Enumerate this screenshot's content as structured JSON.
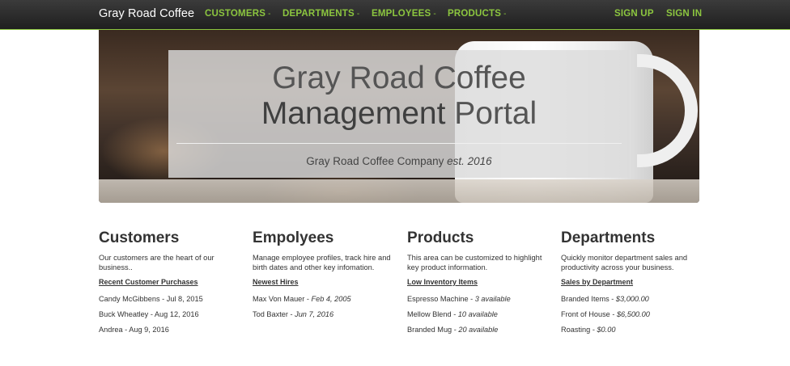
{
  "navbar": {
    "brand": "Gray Road Coffee",
    "menus": [
      {
        "label": "CUSTOMERS",
        "caret": "-"
      },
      {
        "label": "DEPARTMENTS",
        "caret": "-"
      },
      {
        "label": "EMPLOYEES",
        "caret": "-"
      },
      {
        "label": "PRODUCTS",
        "caret": "-"
      }
    ],
    "sign_up": "SIGN UP",
    "sign_in": "SIGN IN",
    "accent_color": "#8cc63f"
  },
  "hero": {
    "title_line1": "Gray Road Coffee",
    "title_line2_bold": "Management",
    "title_line2_rest": " Portal",
    "subtitle_company": "Gray Road Coffee Company ",
    "subtitle_est": "est. 2016"
  },
  "sections": [
    {
      "heading_first": "C",
      "heading_rest": "ustomers",
      "description": "Our customers are the heart of our business..",
      "subheading": "Recent Customer Purchases",
      "items": [
        {
          "label": "Candy McGibbens - Jul 8, 2015",
          "detail": ""
        },
        {
          "label": "Buck Wheatley - Aug 12, 2016",
          "detail": ""
        },
        {
          "label": "Andrea - Aug 9, 2016",
          "detail": ""
        }
      ]
    },
    {
      "heading_first": "E",
      "heading_rest": "mpolyees",
      "description": "Manage employee profiles, track hire and birth dates and other key infomation.",
      "subheading": "Newest Hires",
      "items": [
        {
          "label": "Max Von Mauer - ",
          "detail": "Feb 4, 2005"
        },
        {
          "label": "Tod Baxter - ",
          "detail": "Jun 7, 2016"
        }
      ]
    },
    {
      "heading_first": "P",
      "heading_rest": "roducts",
      "description": "This area can be customized to highlight key product information.",
      "subheading": "Low Inventory Items",
      "items": [
        {
          "label": "Espresso Machine - ",
          "detail": "3 available"
        },
        {
          "label": "Mellow Blend - ",
          "detail": "10 available"
        },
        {
          "label": "Branded Mug - ",
          "detail": "20 available"
        }
      ]
    },
    {
      "heading_first": "D",
      "heading_rest": "epartments",
      "description": "Quickly monitor department sales and productivity across your business.",
      "subheading": "Sales by Department",
      "items": [
        {
          "label": "Branded Items - ",
          "detail": "$3,000.00"
        },
        {
          "label": "Front of House - ",
          "detail": "$6,500.00"
        },
        {
          "label": "Roasting - ",
          "detail": "$0.00"
        }
      ]
    }
  ]
}
